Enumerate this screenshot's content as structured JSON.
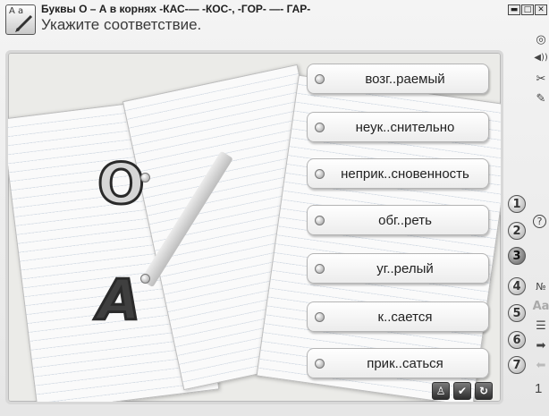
{
  "header": {
    "icon_text": "A a",
    "title": "Буквы О – А в корнях  -КАС-— -КОС-, -ГОР- —- ГАР-",
    "subtitle": "Укажите соответствие."
  },
  "window_controls": [
    "▬",
    "□",
    "✕"
  ],
  "letters": [
    "O",
    "A"
  ],
  "words": [
    "возг..раемый",
    "неук..снительно",
    "неприк..сновенность",
    "обг..реть",
    "уг..релый",
    "к..сается",
    "прик..саться"
  ],
  "bottom_buttons": {
    "person": "♙",
    "check": "✔",
    "undo": "↻"
  },
  "numbers": [
    "1",
    "2",
    "3",
    "4",
    "5",
    "6",
    "7"
  ],
  "active_number": "3",
  "side_icons": {
    "settings": "◎",
    "sound": "◀))",
    "tools": "✂",
    "edit": "✎",
    "help": "?",
    "numbering": "№",
    "text_case": "Aa",
    "list": "☰",
    "forward": "➡",
    "back": "⬅"
  },
  "page_indicator": "1"
}
